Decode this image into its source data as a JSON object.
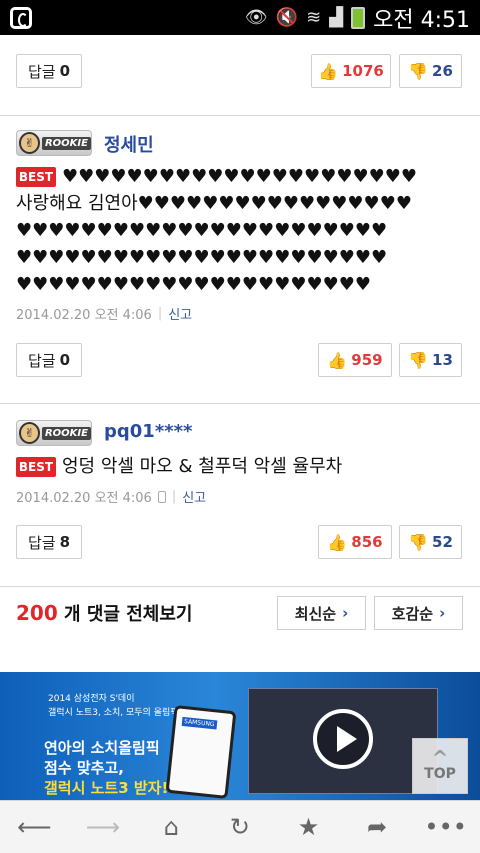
{
  "status_bar": {
    "time": "오전 4:51"
  },
  "comments": [
    {
      "reply_label": "답글",
      "reply_count": "0",
      "likes": "1076",
      "dislikes": "26"
    },
    {
      "badge": "ROOKIE",
      "nickname": "정세민",
      "best": "BEST",
      "text": "♥♥♥♥♥♥♥♥♥♥♥♥♥♥♥♥♥♥♥♥♥♥\n사랑해요 김연아♥♥♥♥♥♥♥♥♥♥♥♥♥♥♥♥♥\n♥♥♥♥♥♥♥♥♥♥♥♥♥♥♥♥♥♥♥♥♥♥♥\n♥♥♥♥♥♥♥♥♥♥♥♥♥♥♥♥♥♥♥♥♥♥♥\n♥♥♥♥♥♥♥♥♥♥♥♥♥♥♥♥♥♥♥♥♥♥",
      "date": "2014.02.20 오전 4:06",
      "report": "신고",
      "reply_label": "답글",
      "reply_count": "0",
      "likes": "959",
      "dislikes": "13"
    },
    {
      "badge": "ROOKIE",
      "nickname": "pq01****",
      "best": "BEST",
      "text": "엉덩 악셀 마오 & 철푸덕 악셀 율무차",
      "date": "2014.02.20 오전 4:06",
      "report": "신고",
      "reply_label": "답글",
      "reply_count": "8",
      "likes": "856",
      "dislikes": "52"
    }
  ],
  "summary": {
    "count": "200",
    "label": "개 댓글 전체보기",
    "sort_latest": "최신순",
    "sort_liked": "호감순"
  },
  "ad": {
    "line1": "2014 삼성전자 S'데이",
    "line2": "갤럭시 노트3, 소치, 모두의 올림픽",
    "headline1": "연아의 소치올림픽",
    "headline2": "점수 맞추고,",
    "headline3": "갤럭시 노트3 받자!",
    "brand": "SAMSUNG"
  },
  "top_button": "TOP",
  "toolbar": {
    "icons": [
      "back-icon",
      "forward-icon",
      "home-icon",
      "refresh-icon",
      "bookmark-star-icon",
      "share-icon",
      "more-icon"
    ]
  }
}
